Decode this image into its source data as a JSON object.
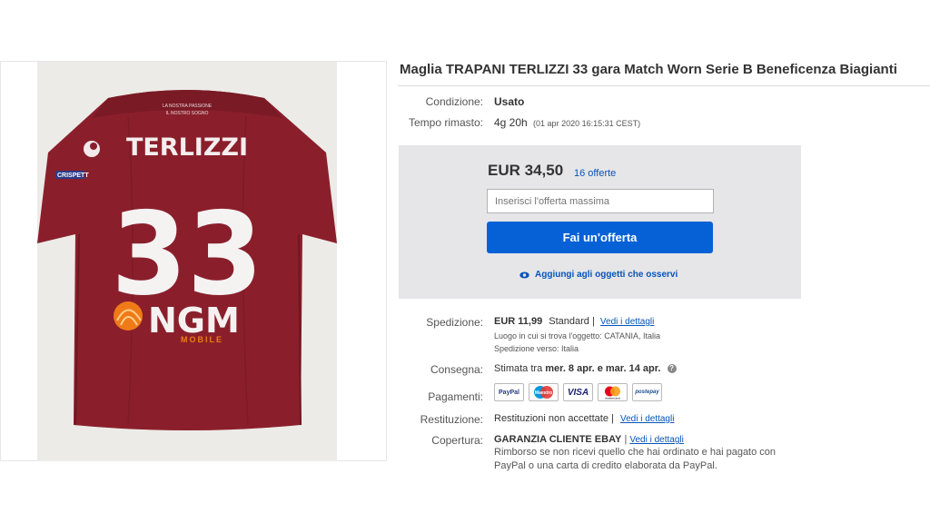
{
  "listing": {
    "title": "Maglia TRAPANI TERLIZZI 33 gara Match Worn Serie B Beneficenza Biagianti"
  },
  "jersey": {
    "name": "TERLIZZI",
    "number": "33",
    "sponsor": "NGM",
    "sponsor_sub": "MOBILE",
    "sleeve_patch": "CRISPETT",
    "collar_text_1": "LA NOSTRA PASSIONE",
    "collar_text_2": "IL NOSTRO SOGNO"
  },
  "details": {
    "condition_label": "Condizione:",
    "condition_value": "Usato",
    "time_label": "Tempo rimasto:",
    "time_value": "4g 20h",
    "time_end": "(01 apr 2020  16:15:31 CEST)"
  },
  "bid": {
    "price": "EUR 34,50",
    "offers": "16 offerte",
    "input_placeholder": "Inserisci l'offerta massima",
    "button_label": "Fai un'offerta",
    "watch_label": "Aggiungi agli oggetti che osservi"
  },
  "shipping": {
    "label": "Spedizione:",
    "price": "EUR 11,99",
    "method": "Standard |",
    "details_link": "Vedi i dettagli",
    "location": "Luogo in cui si trova l'oggetto:  CATANIA, Italia",
    "destination": "Spedizione verso:  Italia"
  },
  "delivery": {
    "label": "Consegna:",
    "prefix": "Stimata tra ",
    "range": "mer. 8 apr. e mar. 14 apr."
  },
  "payments": {
    "label": "Pagamenti:",
    "methods": [
      "PayPal",
      "Maestro",
      "VISA",
      "mastercard",
      "postepay"
    ]
  },
  "returns": {
    "label": "Restituzione:",
    "value": "Restituzioni non accettate |",
    "details_link": "Vedi i dettagli"
  },
  "coverage": {
    "label": "Copertura:",
    "title": "GARANZIA CLIENTE EBAY",
    "details_link": "Vedi i dettagli",
    "line1": "Rimborso se non ricevi quello che hai ordinato e hai pagato con",
    "line2": "PayPal o una carta di credito elaborata da PayPal."
  },
  "colors": {
    "accent_blue": "#0761d6",
    "link_blue": "#0654ba",
    "jersey_red": "#8a1f2b",
    "sponsor_orange": "#f07a18"
  }
}
